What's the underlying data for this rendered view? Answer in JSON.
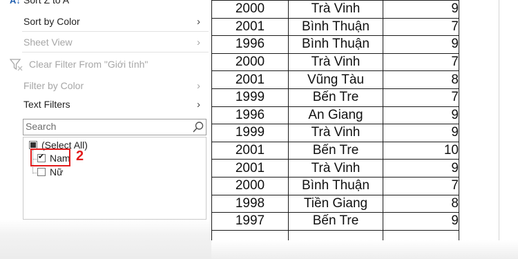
{
  "menu": {
    "sort_z_a": "Sort Z to A",
    "sort_by_color": "Sort by Color",
    "sheet_view": "Sheet View",
    "clear_filter": "Clear Filter From \"Giới tính\"",
    "filter_by_color": "Filter by Color",
    "text_filters": "Text Filters"
  },
  "search": {
    "placeholder": "Search"
  },
  "checklist": {
    "select_all": "(Select All)",
    "items": [
      "Nam",
      "Nữ"
    ]
  },
  "annotation": {
    "step": "2",
    "color": "#e21b1b"
  },
  "table": {
    "rows": [
      {
        "year": "2000",
        "province": "Trà Vinh",
        "score": "9"
      },
      {
        "year": "2001",
        "province": "Bình Thuận",
        "score": "7"
      },
      {
        "year": "1996",
        "province": "Bình Thuận",
        "score": "9"
      },
      {
        "year": "2000",
        "province": "Trà Vinh",
        "score": "7"
      },
      {
        "year": "2001",
        "province": "Vũng Tàu",
        "score": "8"
      },
      {
        "year": "1999",
        "province": "Bến Tre",
        "score": "7"
      },
      {
        "year": "1996",
        "province": "An Giang",
        "score": "9"
      },
      {
        "year": "1999",
        "province": "Trà Vinh",
        "score": "9"
      },
      {
        "year": "2001",
        "province": "Bến Tre",
        "score": "10"
      },
      {
        "year": "2001",
        "province": "Trà Vinh",
        "score": "9"
      },
      {
        "year": "2000",
        "province": "Bình Thuận",
        "score": "7"
      },
      {
        "year": "1998",
        "province": "Tiền Giang",
        "score": "8"
      },
      {
        "year": "1997",
        "province": "Bến Tre",
        "score": "9"
      }
    ]
  }
}
